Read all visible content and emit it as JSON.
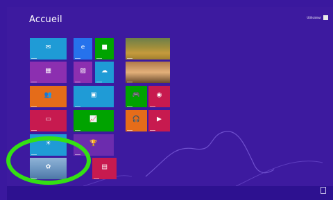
{
  "start": {
    "title": "Accueil",
    "user_name": "Utilisateur"
  },
  "tiles": [
    {
      "name": "mail-tile",
      "color": "#1f9bd6",
      "icon": "mail-icon",
      "glyph": "✉"
    },
    {
      "name": "internet-explorer-tile",
      "color": "#2672ec",
      "icon": "internet-explorer-icon",
      "glyph": "e"
    },
    {
      "name": "store-tile",
      "color": "#00a300",
      "icon": "store-icon",
      "glyph": "■"
    },
    {
      "name": "calendar-tile",
      "color": "#8c2fb0",
      "icon": "calendar-icon",
      "glyph": "▦"
    },
    {
      "name": "photos-tile",
      "color": "#8c2fb0",
      "icon": "photos-icon",
      "glyph": "▨"
    },
    {
      "name": "skydrive-tile",
      "color": "#1f9bd6",
      "icon": "skydrive-icon",
      "glyph": "☁"
    },
    {
      "name": "people-tile",
      "color": "#e56c19",
      "icon": "people-icon",
      "glyph": "👥"
    },
    {
      "name": "image-tile",
      "color": "#1f9bd6",
      "icon": "image-icon",
      "glyph": "▣"
    },
    {
      "name": "messaging-tile",
      "color": "#c71a4f",
      "icon": "messaging-icon",
      "glyph": "▭"
    },
    {
      "name": "finance-tile",
      "color": "#00a300",
      "icon": "finance-icon",
      "glyph": "📈"
    },
    {
      "name": "weather-tile",
      "color": "#1f9bd6",
      "icon": "weather-icon",
      "glyph": "☀"
    },
    {
      "name": "sport-tile",
      "color": "#6c2cae",
      "icon": "trophy-icon",
      "glyph": "🏆"
    },
    {
      "name": "desktop-tile",
      "color": "#5a85b8",
      "icon": "desktop-icon",
      "glyph": "✿"
    },
    {
      "name": "news-tile",
      "color": "#c71a4f",
      "icon": "news-icon",
      "glyph": "▤"
    },
    {
      "name": "bing-tile",
      "color": "#c08a35",
      "icon": "bing-icon",
      "glyph": ""
    },
    {
      "name": "travel-tile",
      "color": "#b07a4a",
      "icon": "travel-icon",
      "glyph": ""
    },
    {
      "name": "games-tile",
      "color": "#00a300",
      "icon": "gamepad-icon",
      "glyph": "🎮"
    },
    {
      "name": "camera-tile",
      "color": "#c71a4f",
      "icon": "camera-icon",
      "glyph": "◉"
    },
    {
      "name": "music-tile",
      "color": "#e56c19",
      "icon": "headphones-icon",
      "glyph": "🎧"
    },
    {
      "name": "video-tile",
      "color": "#c71a4f",
      "icon": "video-icon",
      "glyph": "▶"
    }
  ],
  "highlight_color": "#34e014"
}
